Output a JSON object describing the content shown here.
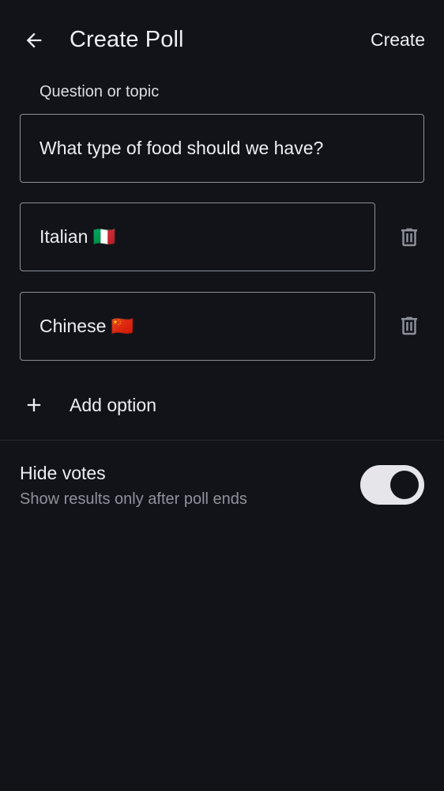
{
  "header": {
    "title": "Create Poll",
    "back_icon": "arrow-left-icon",
    "create_label": "Create"
  },
  "question": {
    "label": "Question or topic",
    "value": "What type of food should we have?"
  },
  "options": [
    {
      "value": "Italian 🇮🇹",
      "delete_icon": "trash-icon"
    },
    {
      "value": "Chinese 🇨🇳",
      "delete_icon": "trash-icon"
    }
  ],
  "add_option": {
    "icon": "plus-icon",
    "label": "Add option"
  },
  "hide_votes": {
    "title": "Hide votes",
    "subtitle": "Show results only after poll ends",
    "enabled": true
  },
  "colors": {
    "background": "#111318",
    "text": "#eceef2",
    "secondary_text": "#8f929a",
    "border": "#8e9099",
    "toggle_track": "#e6e6ea"
  }
}
